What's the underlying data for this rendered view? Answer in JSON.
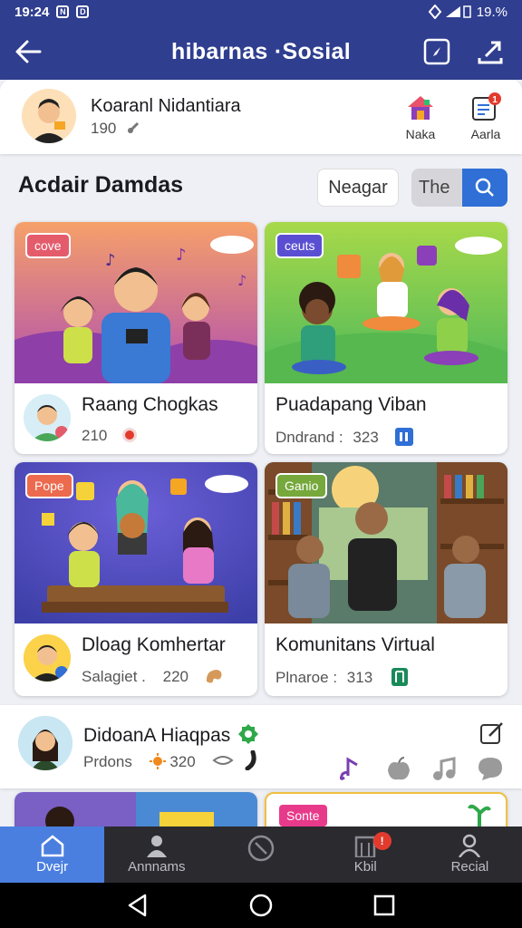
{
  "status_bar": {
    "time": "19:24",
    "battery": "19.%"
  },
  "app_bar": {
    "title": "hibarnas ·Sosial"
  },
  "profile": {
    "name": "Koaranl Nidantiara",
    "count": "190",
    "actions": [
      {
        "label": "Naka"
      },
      {
        "label": "Aarla",
        "badge": "1"
      }
    ]
  },
  "section": {
    "title": "Acdair Damdas",
    "filter_label": "Neagar",
    "search_label": "The"
  },
  "cards": [
    {
      "tag": "cove",
      "name": "Raang Chogkas",
      "meta_label": "",
      "meta_value": "210",
      "tag_color": "#e45c6c"
    },
    {
      "tag": "ceuts",
      "name": "Puadapang Viban",
      "meta_label": "Dndrand :",
      "meta_value": "323",
      "tag_color": "#5a4fd2"
    },
    {
      "tag": "Pope",
      "name": "Dloag Komhertar",
      "meta_label": "Salagiet .",
      "meta_value": "220",
      "tag_color": "#ec6a4e"
    },
    {
      "tag": "Ganio",
      "name": "Komunitans Virtual",
      "meta_label": "Plnaroe :",
      "meta_value": "313",
      "tag_color": "#76a83c"
    }
  ],
  "feed": {
    "name": "DidoanA Hiaqpas",
    "meta_label": "Prdons",
    "meta_value": "320",
    "partial_tag": "Sonte"
  },
  "bottom_nav": [
    {
      "label": "Dvejr",
      "active": true
    },
    {
      "label": "Annnams",
      "active": false
    },
    {
      "label": "",
      "active": false
    },
    {
      "label": "Kbil",
      "active": false,
      "badge": "!"
    },
    {
      "label": "Recial",
      "active": false
    }
  ],
  "colors": {
    "primary": "#2f3e8f",
    "accent": "#2f6fd6",
    "active_tab": "#4a7fe0"
  }
}
